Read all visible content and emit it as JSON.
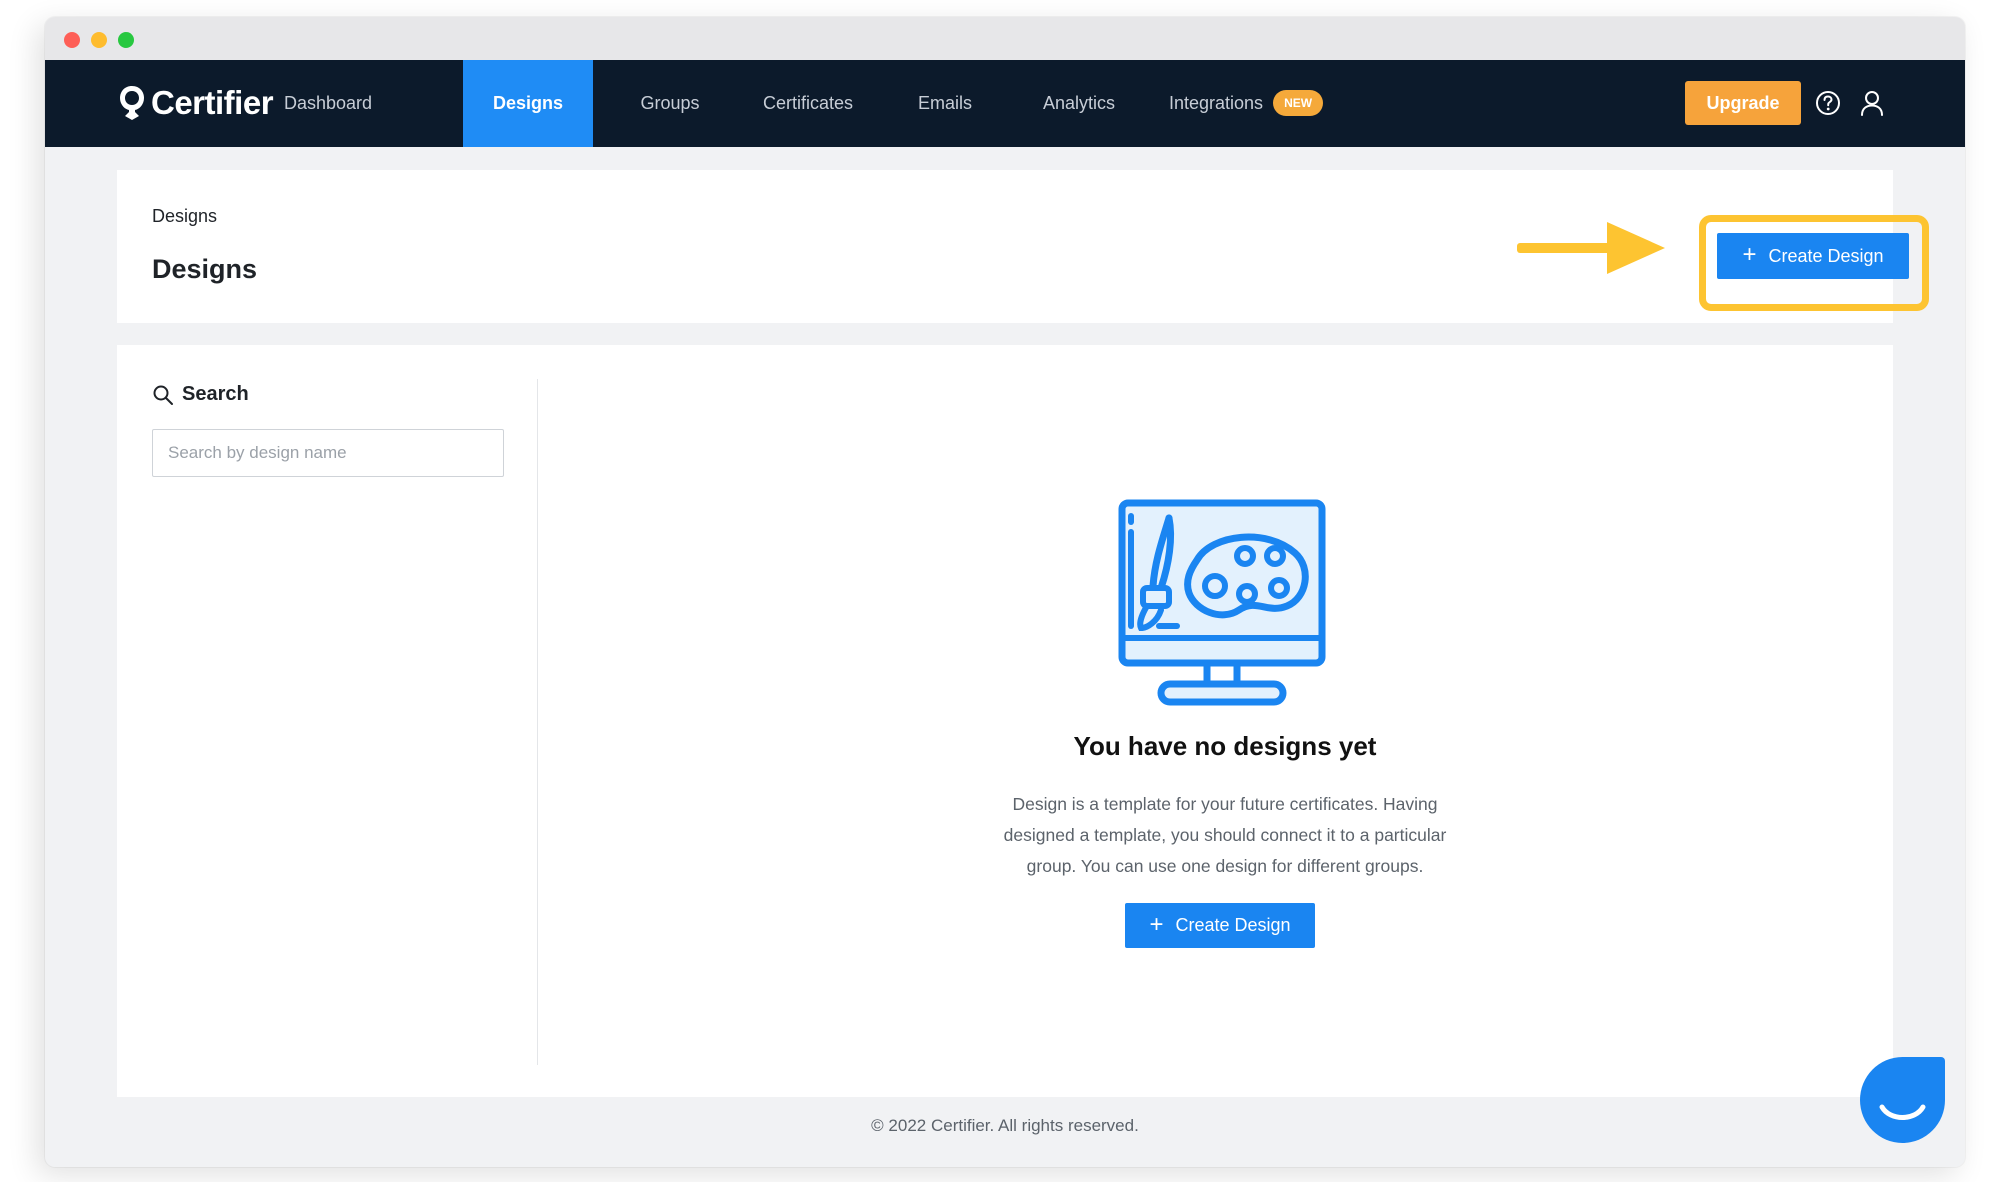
{
  "window": {
    "controls": [
      "close",
      "minimize",
      "zoom"
    ]
  },
  "brand": {
    "name": "Certifier",
    "logo_icon": "certifier-logo-icon"
  },
  "nav": {
    "items": [
      {
        "label": "Dashboard",
        "active": false
      },
      {
        "label": "Designs",
        "active": true
      },
      {
        "label": "Groups",
        "active": false
      },
      {
        "label": "Certificates",
        "active": false
      },
      {
        "label": "Emails",
        "active": false
      },
      {
        "label": "Analytics",
        "active": false
      },
      {
        "label": "Integrations",
        "active": false,
        "badge": "NEW"
      }
    ],
    "upgrade_label": "Upgrade",
    "icons": [
      "help-icon",
      "user-icon"
    ]
  },
  "header": {
    "breadcrumb": "Designs",
    "title": "Designs",
    "create_label": "Create Design"
  },
  "search": {
    "label": "Search",
    "placeholder": "Search by design name",
    "value": ""
  },
  "empty_state": {
    "icon": "design-palette-monitor-icon",
    "title": "You have no designs yet",
    "description": "Design is a template for your future certificates. Having designed a template, you should connect it to a particular group. You can use one design for different groups.",
    "button_label": "Create Design"
  },
  "footer": {
    "text": "© 2022 Certifier. All rights reserved."
  },
  "colors": {
    "nav_bg": "#0c1a2b",
    "active_tab": "#1f8cf5",
    "primary": "#1a85f1",
    "upgrade": "#f6a33b",
    "highlight": "#fdc431",
    "page_bg": "#f1f2f4"
  }
}
